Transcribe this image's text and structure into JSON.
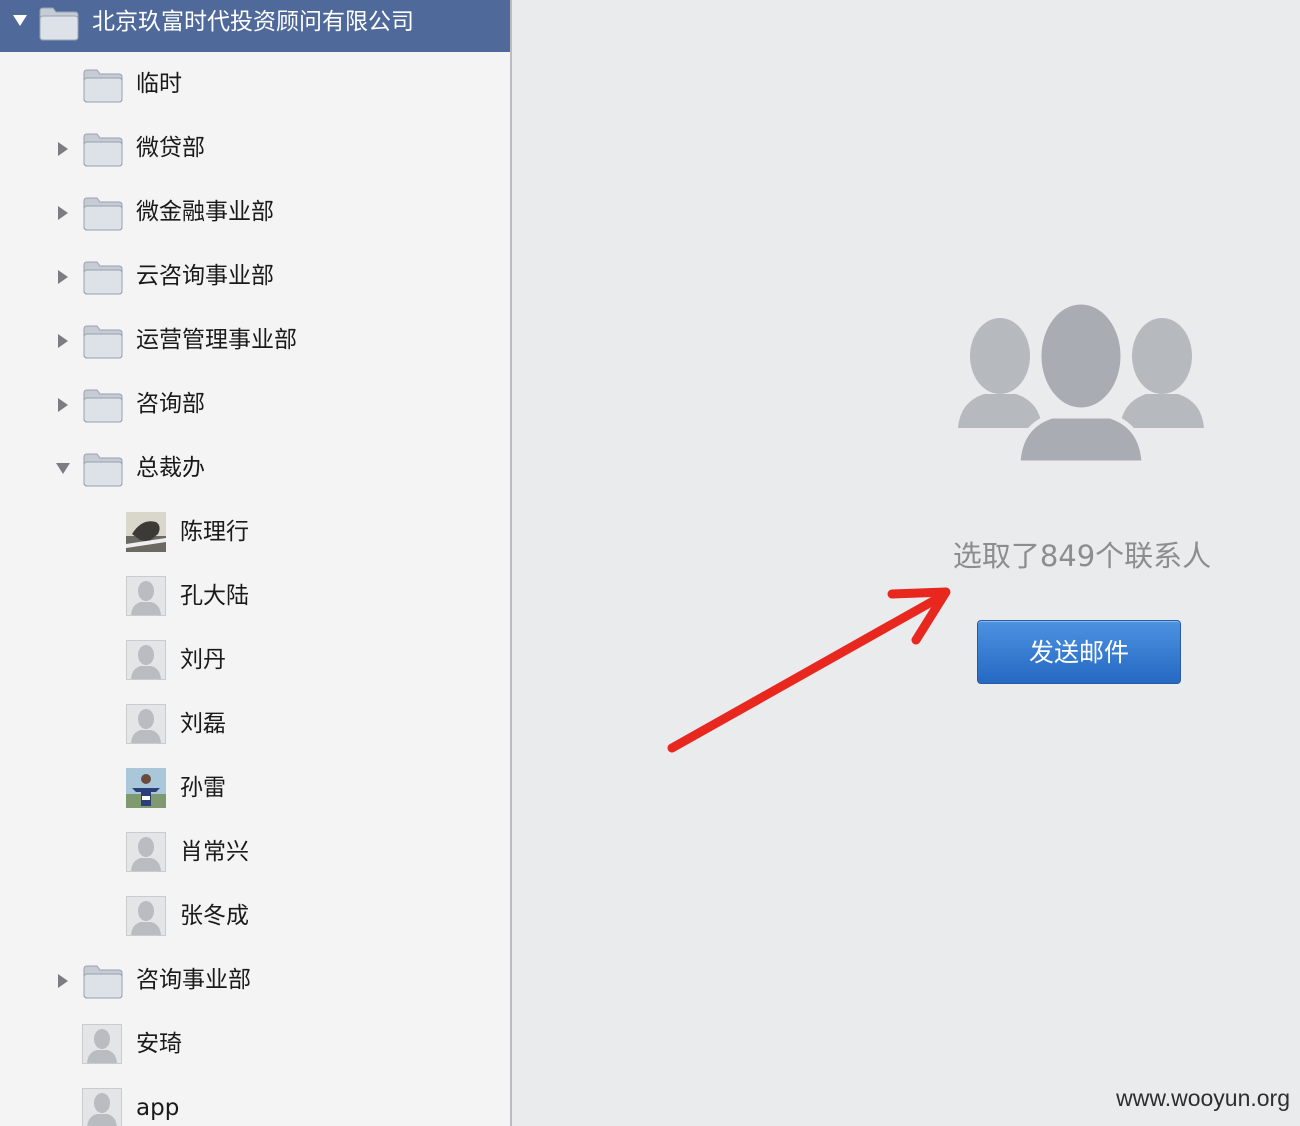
{
  "sidebar": {
    "root": {
      "label": "北京玖富时代投资顾问有限公司",
      "expanded": true
    },
    "items": [
      {
        "type": "folder",
        "label": "临时",
        "indent": 1,
        "disclosure": "none"
      },
      {
        "type": "folder",
        "label": "微贷部",
        "indent": 1,
        "disclosure": "collapsed"
      },
      {
        "type": "folder",
        "label": "微金融事业部",
        "indent": 1,
        "disclosure": "collapsed"
      },
      {
        "type": "folder",
        "label": "云咨询事业部",
        "indent": 1,
        "disclosure": "collapsed"
      },
      {
        "type": "folder",
        "label": "运营管理事业部",
        "indent": 1,
        "disclosure": "collapsed"
      },
      {
        "type": "folder",
        "label": "咨询部",
        "indent": 1,
        "disclosure": "collapsed"
      },
      {
        "type": "folder",
        "label": "总裁办",
        "indent": 1,
        "disclosure": "expanded"
      },
      {
        "type": "contact",
        "label": "陈理行",
        "indent": 2,
        "avatar": "photo-bird"
      },
      {
        "type": "contact",
        "label": "孔大陆",
        "indent": 2,
        "avatar": "placeholder"
      },
      {
        "type": "contact",
        "label": "刘丹",
        "indent": 2,
        "avatar": "placeholder"
      },
      {
        "type": "contact",
        "label": "刘磊",
        "indent": 2,
        "avatar": "placeholder"
      },
      {
        "type": "contact",
        "label": "孙雷",
        "indent": 2,
        "avatar": "photo-person"
      },
      {
        "type": "contact",
        "label": "肖常兴",
        "indent": 2,
        "avatar": "placeholder"
      },
      {
        "type": "contact",
        "label": "张冬成",
        "indent": 2,
        "avatar": "placeholder"
      },
      {
        "type": "folder",
        "label": "咨询事业部",
        "indent": 1,
        "disclosure": "collapsed"
      },
      {
        "type": "contact",
        "label": "安琦",
        "indent": 1,
        "avatar": "placeholder"
      },
      {
        "type": "contact",
        "label": "app",
        "indent": 1,
        "avatar": "placeholder"
      }
    ]
  },
  "main": {
    "selection_text": "选取了849个联系人",
    "send_button": "发送邮件",
    "group_icon": "contacts-group-icon"
  },
  "watermark": "www.wooyun.org",
  "colors": {
    "root_row_bg": "#4f6a9a",
    "sidebar_bg": "#f4f4f4",
    "pane_bg": "#eaebed",
    "button_blue": "#2f72cc",
    "annotation_red": "#e8271f"
  }
}
